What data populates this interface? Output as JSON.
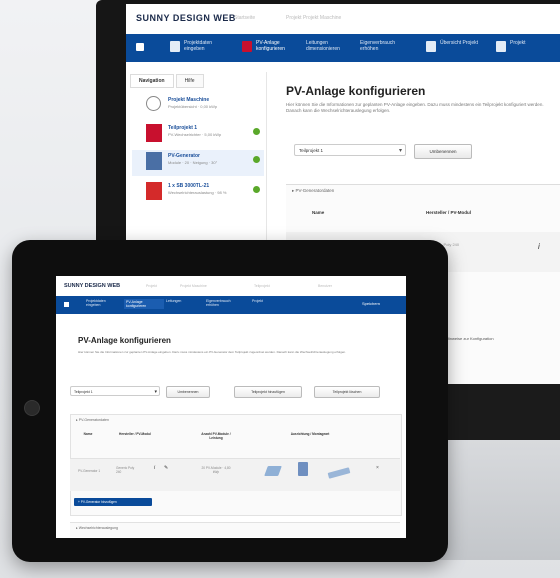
{
  "desktop": {
    "logo": "SUNNY DESIGN WEB",
    "breadcrumb": [
      "Startseite",
      "Projekt Projekt Maschine"
    ],
    "nav_steps": [
      {
        "label": "Projektdaten eingeben",
        "active": false
      },
      {
        "label": "PV-Anlage konfigurieren",
        "active": true
      },
      {
        "label": "Leitungen dimensionieren",
        "active": false
      },
      {
        "label": "Eigenverbrauch erhöhen",
        "active": false
      },
      {
        "label": "Übersicht Projekt",
        "active": false
      },
      {
        "label": "Projekt",
        "active": false
      }
    ],
    "sidebar_tabs": [
      "Navigation",
      "Hilfe"
    ],
    "sidebar_items": [
      {
        "title": "Projekt Maschine",
        "sub": "Projektübersicht · 0,00 kWp",
        "status": false
      },
      {
        "title": "Teilprojekt 1",
        "sub": "PV-Wechselrichter · 5,00 kWp",
        "status": true
      },
      {
        "title": "PV-Generator",
        "sub": "Module · 20 · Neigung · 30°",
        "status": true
      },
      {
        "title": "1 x SB 3000TL-21",
        "sub": "Wechselrichterauslastung · 98 %",
        "status": true
      }
    ],
    "page_title": "PV-Anlage konfigurieren",
    "intro": "Hier können Sie die Informationen zur geplanten PV-Anlage eingeben. Dazu muss mindestens ein Teilprojekt konfiguriert werden. Danach kann die Wechselrichterauslegung erfolgen.",
    "select_value": "Teilprojekt 1",
    "rename_button": "Umbenennen",
    "panel_title": "PV-Generatordaten",
    "table_headers": [
      "Name",
      "Hersteller / PV-Modul"
    ],
    "row_text": "Generic · Poly 240",
    "info_symbol": "i",
    "hint": "Hinweise zur Konfiguration"
  },
  "tablet": {
    "logo": "SUNNY DESIGN WEB",
    "breadcrumb": [
      "Projekt",
      "Projekt Maschine",
      "Teilprojekt",
      "Benutzer"
    ],
    "nav_steps": [
      {
        "label": "Projektdaten eingeben",
        "active": false
      },
      {
        "label": "PV-Anlage konfigurieren",
        "active": true
      },
      {
        "label": "Leitungen",
        "active": false
      },
      {
        "label": "Eigenverbrauch erhöhen",
        "active": false
      },
      {
        "label": "Projekt",
        "active": false
      }
    ],
    "nav_right": "Speichern",
    "page_title": "PV-Anlage konfigurieren",
    "intro": "Hier können Sie die Informationen zur geplanten PV-Anlage eingeben. Dazu muss mindestens ein PV-Generator dem Teilprojekt zugeordnet werden. Danach kann die Wechselrichterauslegung erfolgen.",
    "select_value": "Teilprojekt 1",
    "buttons": [
      "Umbenennen",
      "Teilprojekt hinzufügen",
      "Teilprojekt löschen"
    ],
    "panel_title": "PV-Generatordaten",
    "table_headers": [
      "Name",
      "Hersteller / PV-Modul",
      "Anzahl PV-Module / Leistung",
      "Ausrichtung / Montageart"
    ],
    "row": {
      "name": "PV-Generator 1",
      "module": "Generic Poly 240",
      "count": "20 PV-Module · 4,80 kWp"
    },
    "add_button": "PV-Generator hinzufügen",
    "footer_panel": "Wechselrichterauslegung"
  },
  "colors": {
    "nav_blue": "#0a4b9a",
    "ok_green": "#5aa82a",
    "accent_red": "#c8102e"
  }
}
